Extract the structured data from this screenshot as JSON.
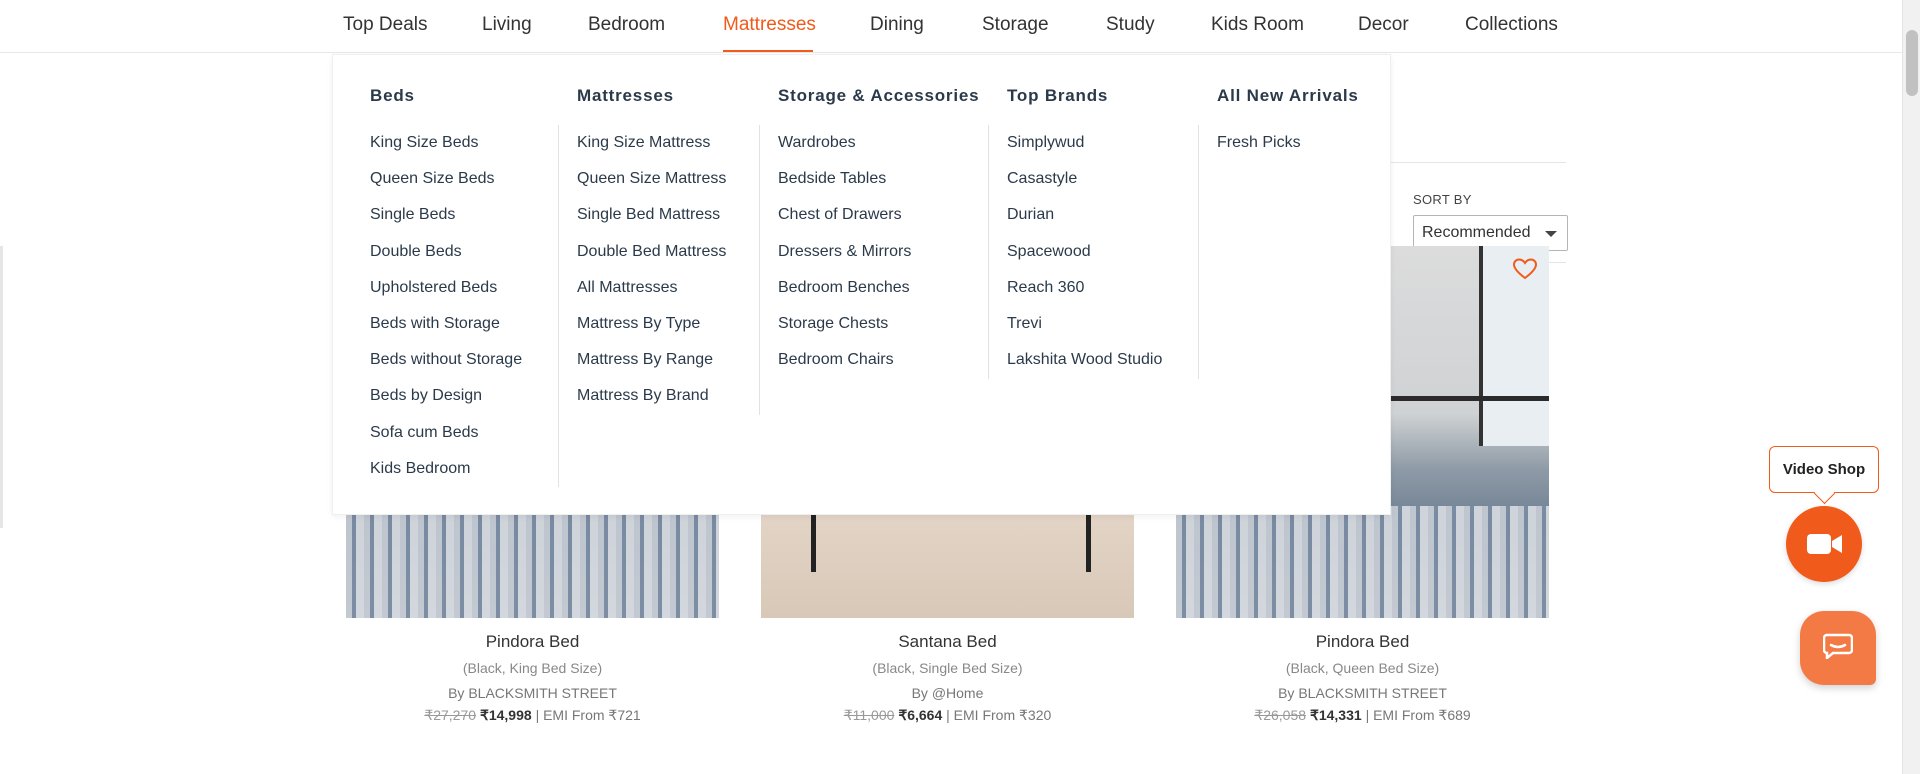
{
  "topnav": {
    "items": [
      {
        "label": "Top Deals"
      },
      {
        "label": "Living"
      },
      {
        "label": "Bedroom"
      },
      {
        "label": "Mattresses"
      },
      {
        "label": "Dining"
      },
      {
        "label": "Storage"
      },
      {
        "label": "Study"
      },
      {
        "label": "Kids Room"
      },
      {
        "label": "Decor"
      },
      {
        "label": "Collections"
      }
    ],
    "active": "Mattresses"
  },
  "mega_menu": {
    "columns": [
      {
        "heading": "Beds",
        "links": [
          "King Size Beds",
          "Queen Size Beds",
          "Single Beds",
          "Double Beds",
          "Upholstered Beds",
          "Beds with Storage",
          "Beds without Storage",
          "Beds by Design",
          "Sofa cum Beds",
          "Kids Bedroom"
        ]
      },
      {
        "heading": "Mattresses",
        "links": [
          "King Size Mattress",
          "Queen Size Mattress",
          "Single Bed Mattress",
          "Double Bed Mattress",
          "All Mattresses",
          "Mattress By Type",
          "Mattress By Range",
          "Mattress By Brand"
        ]
      },
      {
        "heading": "Storage & Accessories",
        "links": [
          "Wardrobes",
          "Bedside Tables",
          "Chest of Drawers",
          "Dressers & Mirrors",
          "Bedroom Benches",
          "Storage Chests",
          "Bedroom Chairs"
        ]
      },
      {
        "heading": "Top Brands",
        "links": [
          "Simplywud",
          "Casastyle",
          "Durian",
          "Spacewood",
          "Reach 360",
          "Trevi",
          "Lakshita Wood Studio"
        ]
      },
      {
        "heading": "All New Arrivals",
        "links": [
          "Fresh Picks"
        ]
      }
    ]
  },
  "sort": {
    "label": "SORT BY",
    "value": "Recommended"
  },
  "products": [
    {
      "name": "Pindora Bed",
      "variant": "(Black, King Bed Size)",
      "brand": "By BLACKSMITH STREET",
      "mrp": "₹27,270",
      "price": "₹14,998",
      "emi": "| EMI From ₹721"
    },
    {
      "name": "Santana Bed",
      "variant": "(Black, Single Bed Size)",
      "brand": "By @Home",
      "mrp": "₹11,000",
      "price": "₹6,664",
      "emi": "| EMI From ₹320"
    },
    {
      "name": "Pindora Bed",
      "variant": "(Black, Queen Bed Size)",
      "brand": "By BLACKSMITH STREET",
      "mrp": "₹26,058",
      "price": "₹14,331",
      "emi": "| EMI From ₹689"
    }
  ],
  "widgets": {
    "video_shop_label": "Video Shop"
  },
  "icons": {
    "wishlist": "heart-icon",
    "video": "video-camera-icon",
    "chat": "chat-bubble-icon"
  },
  "colors": {
    "accent": "#f05a1a",
    "text": "#2b3a4a"
  }
}
